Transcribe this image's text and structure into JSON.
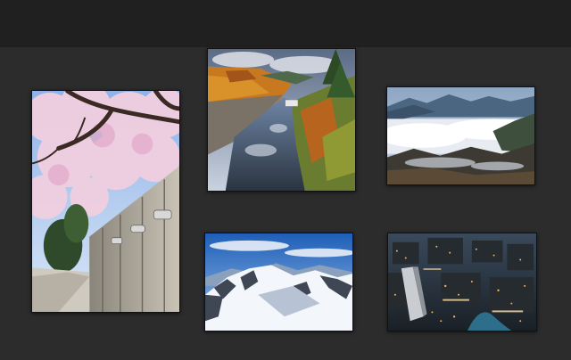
{
  "gallery": {
    "photos": [
      {
        "subject": "cherry-blossom-stone-wall"
      },
      {
        "subject": "autumn-canal"
      },
      {
        "subject": "sea-of-clouds-mountains"
      },
      {
        "subject": "snowy-mountain-range"
      },
      {
        "subject": "city-aerial-dusk"
      }
    ]
  },
  "colors": {
    "toolbar": "#202020",
    "canvas": "#2c2c2c",
    "photo_border": "#111111"
  }
}
